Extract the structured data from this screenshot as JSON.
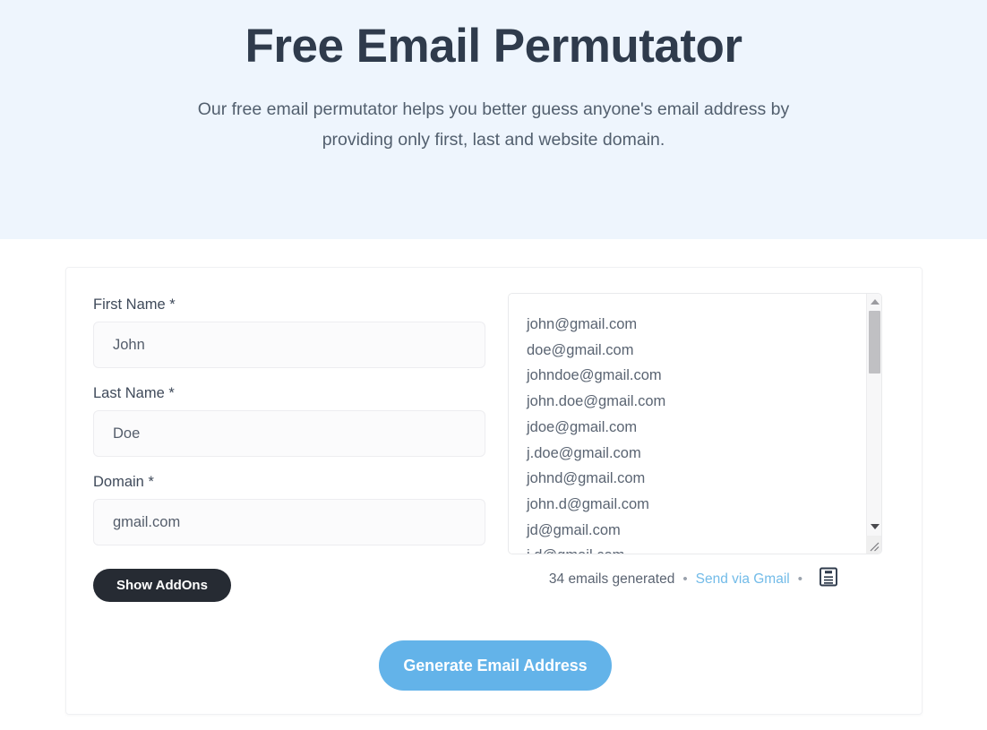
{
  "hero": {
    "title": "Free Email Permutator",
    "subtitle": "Our free email permutator helps you better guess anyone's email address by providing only first, last and website domain."
  },
  "form": {
    "first_name": {
      "label": "First Name *",
      "value": "John",
      "placeholder": "John"
    },
    "last_name": {
      "label": "Last Name *",
      "value": "Doe",
      "placeholder": "Doe"
    },
    "domain": {
      "label": "Domain *",
      "value": "gmail.com",
      "placeholder": "gmail.com"
    },
    "addons_button": "Show AddOns",
    "generate_button": "Generate Email Address"
  },
  "results": {
    "emails": [
      "john@gmail.com",
      "doe@gmail.com",
      "johndoe@gmail.com",
      "john.doe@gmail.com",
      "jdoe@gmail.com",
      "j.doe@gmail.com",
      "johnd@gmail.com",
      "john.d@gmail.com",
      "jd@gmail.com",
      "j.d@gmail.com"
    ],
    "count_text": "34 emails generated",
    "separator": "•",
    "send_link": "Send via Gmail",
    "copy_icon": "clipboard-save-icon"
  },
  "colors": {
    "hero_bg": "#eef5fd",
    "title": "#2f3b4c",
    "accent_blue": "#63b3e9",
    "link_blue": "#72bbe8",
    "dark_button": "#262b33"
  }
}
